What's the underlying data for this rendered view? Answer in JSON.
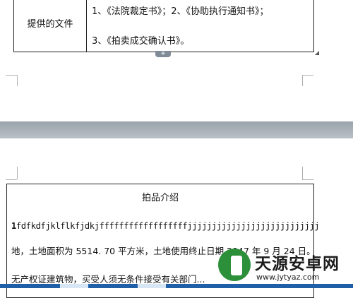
{
  "top_table": {
    "label": "提供的文件",
    "line1": "1、《法院裁定书》；2、《协助执行通知书》；",
    "line2": "3、《拍卖成交确认书》。"
  },
  "controls": {
    "add_row": "+"
  },
  "bottom_table": {
    "title": "拍品介绍",
    "row1_bold": "1",
    "row1_rest": "fdfkdfjklflkfjdkjffffffffffffffffffjjjjjjjjjjjjjjjjjjjjjjjjjjj",
    "row2": "地，土地面积为 5514. 70 平方米，土地使用终止日期 2047 年 9 月 24 日。",
    "row3": "无产权证建筑物，买受人须无条件接受有关部门..."
  },
  "watermark": {
    "name": "天源安卓网",
    "url": "www.jytyaz.com"
  },
  "colors": {
    "gap": "#a9b1b8",
    "watermark_green": "#2c8f3a",
    "taskbar": "#1f5fa8"
  }
}
